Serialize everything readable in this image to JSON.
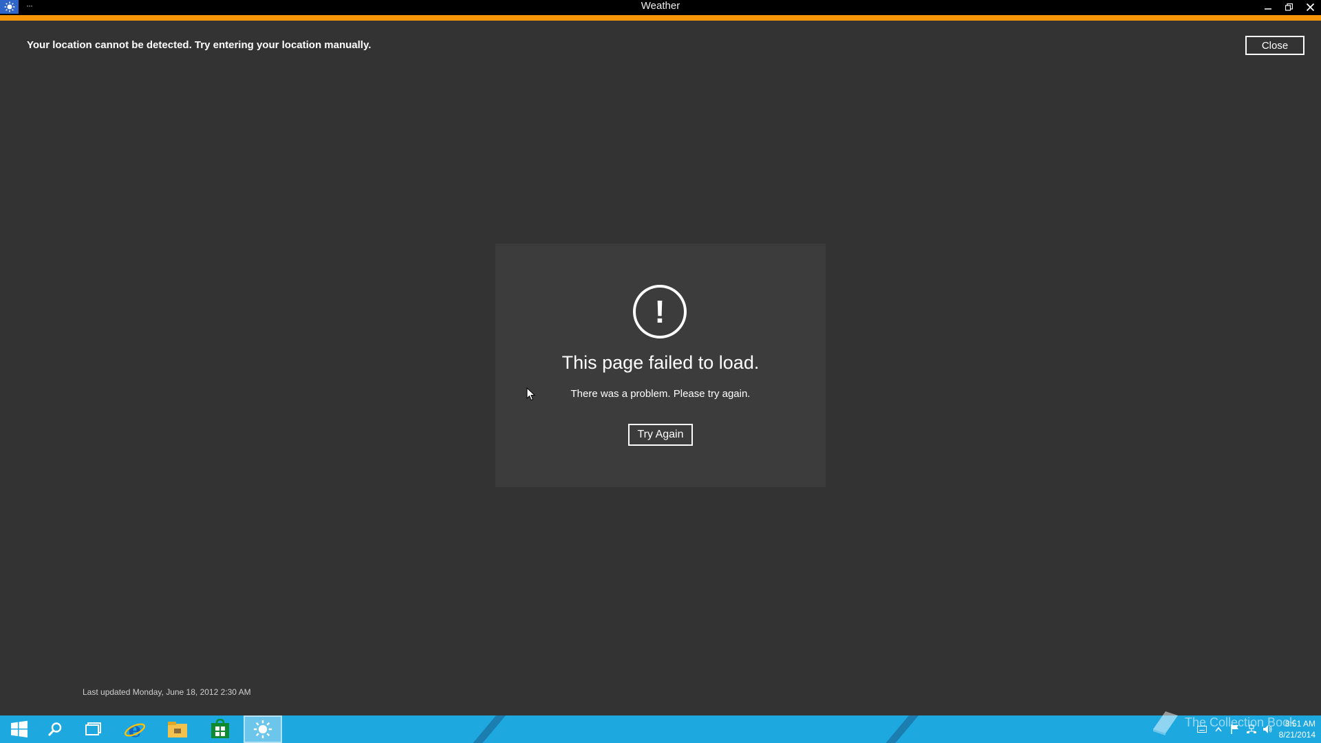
{
  "window": {
    "title": "Weather",
    "menu_dots": "···"
  },
  "notification": {
    "message": "Your location cannot be detected. Try entering your location manually.",
    "close_label": "Close"
  },
  "error": {
    "title": "This page failed to load.",
    "subtitle": "There was a problem. Please try again.",
    "button_label": "Try Again",
    "icon_glyph": "!"
  },
  "footer": {
    "last_updated": "Last updated Monday, June 18, 2012 2:30 AM"
  },
  "taskbar": {
    "items": [
      "start-icon",
      "search-icon",
      "task-view-icon",
      "internet-explorer-icon",
      "file-explorer-icon",
      "store-icon",
      "weather-icon"
    ],
    "active_item": "weather-icon",
    "clock_time": "8:51 AM",
    "clock_date": "8/21/2014"
  },
  "watermark": {
    "text": "The Collection Book"
  },
  "colors": {
    "accent": "#f5960a",
    "background": "#333333",
    "card": "#3c3c3c",
    "taskbar": "#1ea8e0",
    "app_icon": "#2f64c8"
  }
}
